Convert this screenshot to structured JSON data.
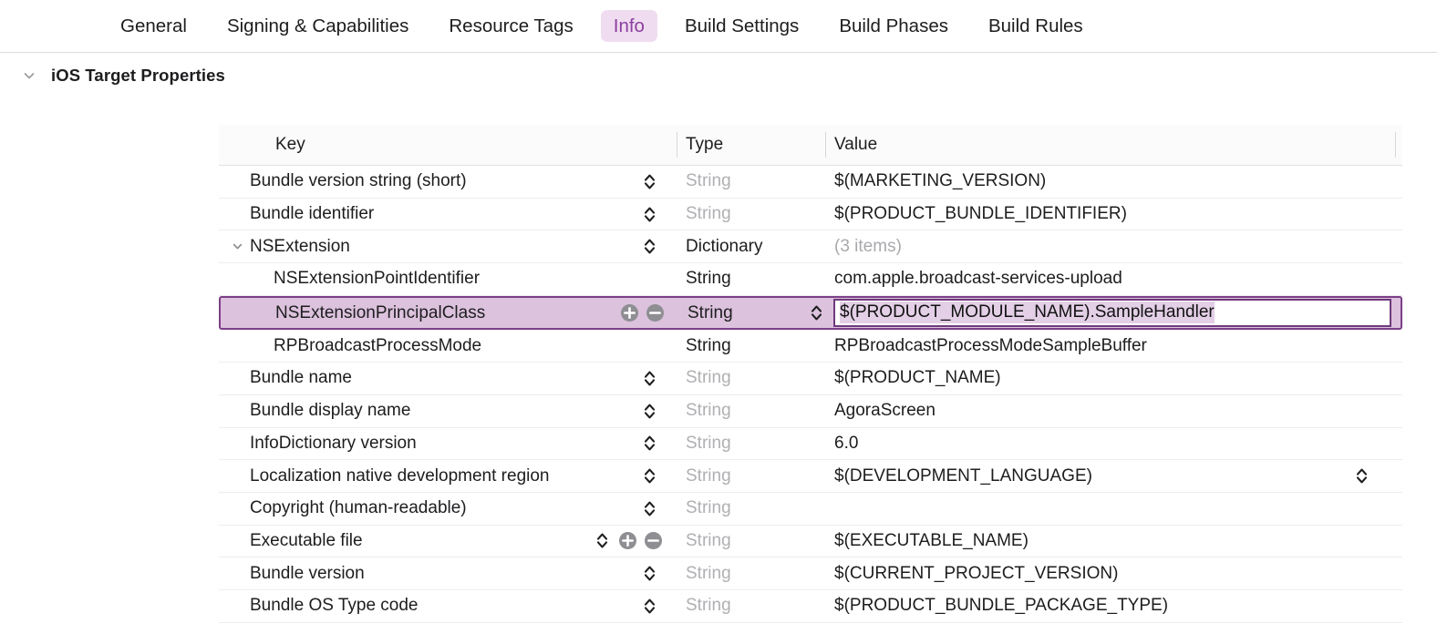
{
  "tabs": [
    {
      "label": "General",
      "active": false
    },
    {
      "label": "Signing & Capabilities",
      "active": false
    },
    {
      "label": "Resource Tags",
      "active": false
    },
    {
      "label": "Info",
      "active": true
    },
    {
      "label": "Build Settings",
      "active": false
    },
    {
      "label": "Build Phases",
      "active": false
    },
    {
      "label": "Build Rules",
      "active": false
    }
  ],
  "section": {
    "title": "iOS Target Properties",
    "expanded": true,
    "disclosure_icon": "chevron-down-icon"
  },
  "table": {
    "headers": {
      "key": "Key",
      "type": "Type",
      "value": "Value"
    },
    "rows": [
      {
        "key": "Bundle version string (short)",
        "type": "String",
        "type_dim": true,
        "value": "$(MARKETING_VERSION)",
        "indent": 0,
        "stepper": true,
        "add_remove": false,
        "selected": false
      },
      {
        "key": "Bundle identifier",
        "type": "String",
        "type_dim": true,
        "value": "$(PRODUCT_BUNDLE_IDENTIFIER)",
        "indent": 0,
        "stepper": true,
        "add_remove": false,
        "selected": false
      },
      {
        "key": "NSExtension",
        "type": "Dictionary",
        "type_dim": false,
        "value": "(3 items)",
        "value_dim": true,
        "indent": 0,
        "stepper": true,
        "add_remove": false,
        "selected": false,
        "disclosure": "chevron-down-icon"
      },
      {
        "key": "NSExtensionPointIdentifier",
        "type": "String",
        "type_dim": false,
        "value": "com.apple.broadcast-services-upload",
        "indent": 1,
        "stepper": false,
        "add_remove": false,
        "selected": false
      },
      {
        "key": "NSExtensionPrincipalClass",
        "type": "String",
        "type_dim": false,
        "value": "$(PRODUCT_MODULE_NAME).SampleHandler",
        "indent": 1,
        "stepper": false,
        "add_remove": true,
        "selected": true,
        "editing": true,
        "type_stepper": true
      },
      {
        "key": "RPBroadcastProcessMode",
        "type": "String",
        "type_dim": false,
        "value": "RPBroadcastProcessModeSampleBuffer",
        "indent": 1,
        "stepper": false,
        "add_remove": false,
        "selected": false
      },
      {
        "key": "Bundle name",
        "type": "String",
        "type_dim": true,
        "value": "$(PRODUCT_NAME)",
        "indent": 0,
        "stepper": true,
        "add_remove": false,
        "selected": false
      },
      {
        "key": "Bundle display name",
        "type": "String",
        "type_dim": true,
        "value": "AgoraScreen",
        "indent": 0,
        "stepper": true,
        "add_remove": false,
        "selected": false
      },
      {
        "key": "InfoDictionary version",
        "type": "String",
        "type_dim": true,
        "value": "6.0",
        "indent": 0,
        "stepper": true,
        "add_remove": false,
        "selected": false
      },
      {
        "key": "Localization native development region",
        "type": "String",
        "type_dim": true,
        "value": "$(DEVELOPMENT_LANGUAGE)",
        "indent": 0,
        "stepper": true,
        "add_remove": false,
        "selected": false,
        "value_stepper": true
      },
      {
        "key": "Copyright (human-readable)",
        "type": "String",
        "type_dim": true,
        "value": "",
        "indent": 0,
        "stepper": true,
        "add_remove": false,
        "selected": false
      },
      {
        "key": "Executable file",
        "type": "String",
        "type_dim": true,
        "value": "$(EXECUTABLE_NAME)",
        "indent": 0,
        "stepper": true,
        "add_remove": true,
        "selected": false
      },
      {
        "key": "Bundle version",
        "type": "String",
        "type_dim": true,
        "value": "$(CURRENT_PROJECT_VERSION)",
        "indent": 0,
        "stepper": true,
        "add_remove": false,
        "selected": false
      },
      {
        "key": "Bundle OS Type code",
        "type": "String",
        "type_dim": true,
        "value": "$(PRODUCT_BUNDLE_PACKAGE_TYPE)",
        "indent": 0,
        "stepper": true,
        "add_remove": false,
        "selected": false
      }
    ]
  },
  "colors": {
    "accent_purple": "#8b3fa0",
    "tab_active_bg": "#f0dcf0",
    "selected_row_bg": "#dcc2dd",
    "selected_row_border": "#7c3f87",
    "selection_highlight": "#e3cfe6",
    "dim_text": "#b0b0b4"
  }
}
